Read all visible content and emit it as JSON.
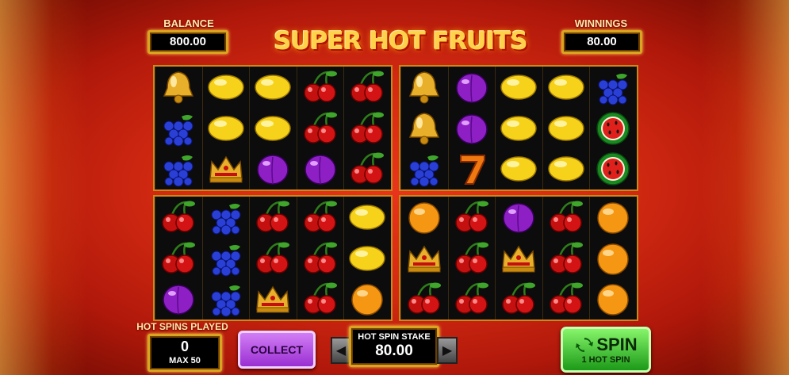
{
  "game": {
    "title": "SUPER HOT FRUITS"
  },
  "balance": {
    "label": "BALANCE",
    "value": "800.00"
  },
  "winnings": {
    "label": "WINNINGS",
    "value": "80.00"
  },
  "hot_spins": {
    "label": "HOT SPINS PLAYED",
    "count": "0",
    "max": "MAX 50"
  },
  "collect": {
    "label": "COLLECT"
  },
  "stake": {
    "label": "HOT SPIN STAKE",
    "value": "80.00"
  },
  "spin": {
    "label": "SPIN",
    "sub": "1 HOT SPIN"
  },
  "grids": [
    {
      "reels": [
        [
          "bell",
          "grapes",
          "grapes"
        ],
        [
          "lemon",
          "lemon",
          "crown"
        ],
        [
          "lemon",
          "lemon",
          "plum"
        ],
        [
          "cherry",
          "cherry",
          "plum"
        ],
        [
          "cherry",
          "cherry",
          "cherry"
        ]
      ]
    },
    {
      "reels": [
        [
          "bell",
          "bell",
          "grapes"
        ],
        [
          "plum",
          "plum",
          "seven"
        ],
        [
          "lemon",
          "lemon",
          "lemon"
        ],
        [
          "lemon",
          "lemon",
          "lemon"
        ],
        [
          "grapes",
          "melon",
          "melon"
        ]
      ]
    },
    {
      "reels": [
        [
          "cherry",
          "cherry",
          "plum"
        ],
        [
          "grapes",
          "grapes",
          "grapes"
        ],
        [
          "cherry",
          "cherry",
          "crown"
        ],
        [
          "cherry",
          "cherry",
          "cherry"
        ],
        [
          "lemon",
          "lemon",
          "orange"
        ]
      ]
    },
    {
      "reels": [
        [
          "orange",
          "crown",
          "cherry"
        ],
        [
          "cherry",
          "cherry",
          "cherry"
        ],
        [
          "plum",
          "crown",
          "cherry"
        ],
        [
          "cherry",
          "cherry",
          "cherry"
        ],
        [
          "orange",
          "orange",
          "orange"
        ]
      ]
    }
  ]
}
